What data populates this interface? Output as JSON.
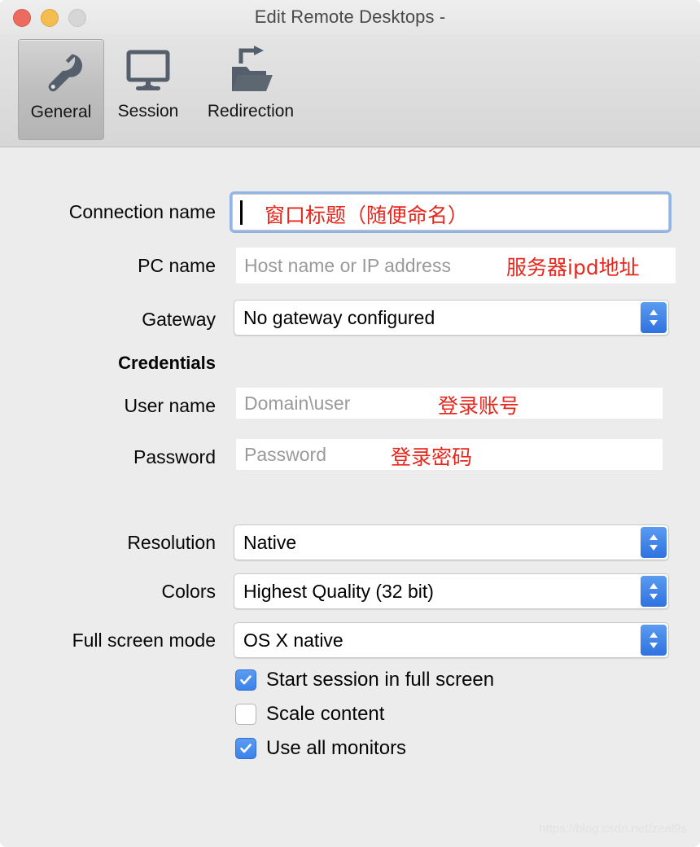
{
  "window": {
    "title": "Edit Remote Desktops -",
    "traffic_lights": [
      {
        "name": "close",
        "color": "#ec6b5f"
      },
      {
        "name": "minimize",
        "color": "#f4bd4f"
      },
      {
        "name": "maximize",
        "color": "#d6d6d6"
      }
    ]
  },
  "toolbar": {
    "tabs": [
      {
        "label": "General",
        "icon": "wrench-icon",
        "selected": true
      },
      {
        "label": "Session",
        "icon": "monitor-icon",
        "selected": false
      },
      {
        "label": "Redirection",
        "icon": "folder-redirect-icon",
        "selected": false
      }
    ]
  },
  "form": {
    "connection_name": {
      "label": "Connection name",
      "value": "",
      "placeholder": "",
      "annotation": "窗口标题（随便命名）",
      "focused": true
    },
    "pc_name": {
      "label": "PC name",
      "value": "",
      "placeholder": "Host name or IP address",
      "annotation": "服务器ipd地址"
    },
    "gateway": {
      "label": "Gateway",
      "selected": "No gateway configured"
    },
    "credentials_heading": "Credentials",
    "user_name": {
      "label": "User name",
      "value": "",
      "placeholder": "Domain\\user",
      "annotation": "登录账号"
    },
    "password": {
      "label": "Password",
      "value": "",
      "placeholder": "Password",
      "annotation": "登录密码"
    },
    "resolution": {
      "label": "Resolution",
      "selected": "Native"
    },
    "colors": {
      "label": "Colors",
      "selected": "Highest Quality (32 bit)"
    },
    "full_screen_mode": {
      "label": "Full screen mode",
      "selected": "OS X native"
    },
    "checkboxes": [
      {
        "label": "Start session in full screen",
        "checked": true
      },
      {
        "label": "Scale content",
        "checked": false
      },
      {
        "label": "Use all monitors",
        "checked": true
      }
    ]
  },
  "watermark": "https://blog.csdn.net/zeal9s",
  "colors": {
    "accent_blue": "#3b82ec",
    "annotation_red": "#e8261c",
    "window_bg": "#ececec",
    "toolbar_bg": "#d6d6d6"
  }
}
